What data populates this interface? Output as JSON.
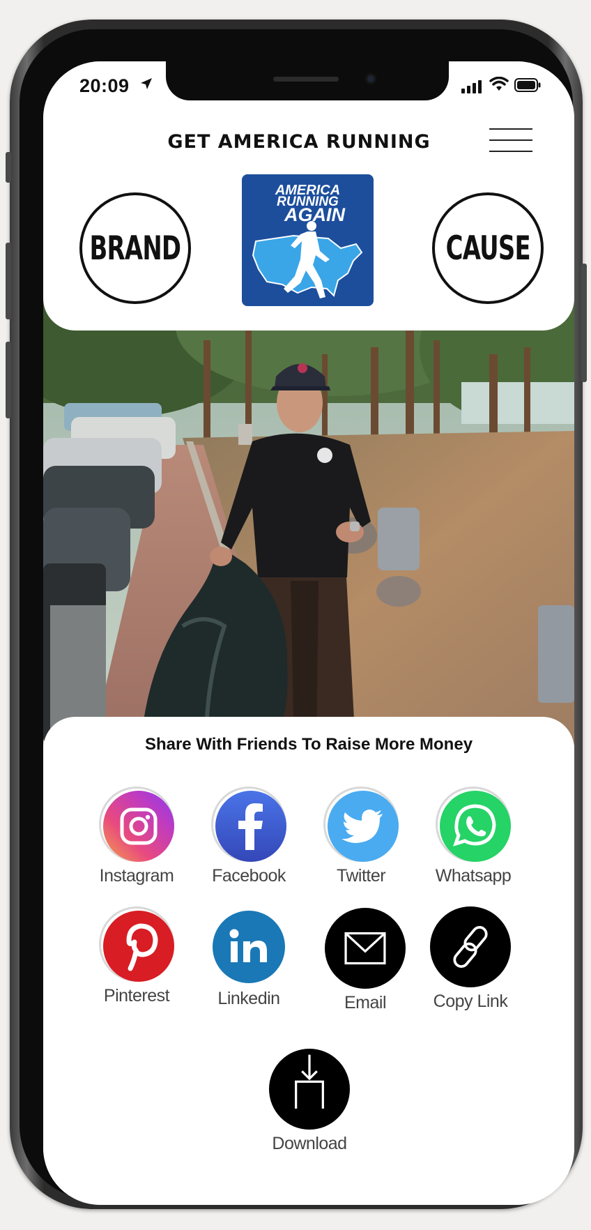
{
  "status_bar": {
    "time": "20:09"
  },
  "header": {
    "title": "GET AMERICA RUNNING",
    "brand_label": "BRAND",
    "cause_label": "CAUSE",
    "logo": {
      "line1": "AMERICA",
      "line2": "RUNNING",
      "line3": "AGAIN"
    }
  },
  "share": {
    "title": "Share With Friends To Raise More Money",
    "buttons": [
      {
        "label": "Instagram",
        "icon": "instagram-icon"
      },
      {
        "label": "Facebook",
        "icon": "facebook-icon"
      },
      {
        "label": "Twitter",
        "icon": "twitter-icon"
      },
      {
        "label": "Whatsapp",
        "icon": "whatsapp-icon"
      },
      {
        "label": "Pinterest",
        "icon": "pinterest-icon"
      },
      {
        "label": "Linkedin",
        "icon": "linkedin-icon"
      },
      {
        "label": "Email",
        "icon": "email-icon"
      },
      {
        "label": "Copy Link",
        "icon": "link-icon"
      }
    ],
    "download_label": "Download"
  },
  "colors": {
    "logo_bg": "#1d4e9c",
    "map_blue": "#3aa6e8",
    "facebook": "#3b5ccc",
    "twitter": "#4aabf0",
    "whatsapp": "#25d366",
    "pinterest": "#d81d24",
    "linkedin": "#1a78b6"
  }
}
